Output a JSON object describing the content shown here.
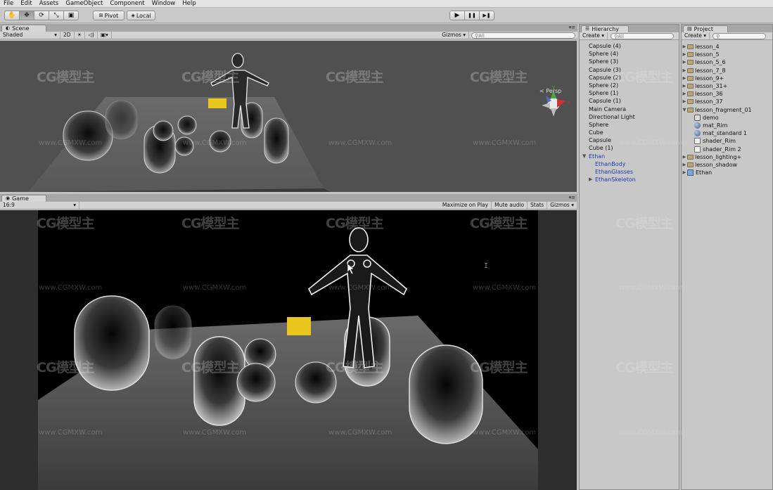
{
  "menu": [
    "File",
    "Edit",
    "Assets",
    "GameObject",
    "Component",
    "Window",
    "Help"
  ],
  "toolbar": {
    "tools": [
      "hand-icon",
      "move-icon",
      "rotate-icon",
      "scale-icon",
      "rect-icon"
    ],
    "pivot": "Pivot",
    "local": "Local",
    "play": "▶",
    "pause": "❚❚",
    "step": "▶❚"
  },
  "scene": {
    "tab": "Scene",
    "shading": "Shaded",
    "mode2d": "2D",
    "gizmos": "Gizmos",
    "search_placeholder": "All",
    "persp_label": "< Persp",
    "axis_x": "x",
    "axis_y": "y"
  },
  "game": {
    "tab": "Game",
    "aspect": "16:9",
    "buttons": [
      "Maximize on Play",
      "Mute audio",
      "Stats",
      "Gizmos"
    ]
  },
  "hierarchy": {
    "tab": "Hierarchy",
    "create": "Create",
    "search_placeholder": "All",
    "items": [
      {
        "label": "Capsule (4)"
      },
      {
        "label": "Sphere (4)"
      },
      {
        "label": "Sphere (3)"
      },
      {
        "label": "Capsule (3)"
      },
      {
        "label": "Capsule (2)"
      },
      {
        "label": "Sphere (2)"
      },
      {
        "label": "Sphere (1)"
      },
      {
        "label": "Capsule (1)"
      },
      {
        "label": "Main Camera"
      },
      {
        "label": "Directional Light"
      },
      {
        "label": "Sphere"
      },
      {
        "label": "Cube"
      },
      {
        "label": "Capsule"
      },
      {
        "label": "Cube (1)"
      },
      {
        "label": "Ethan"
      },
      {
        "label": "EthanBody"
      },
      {
        "label": "EthanGlasses"
      },
      {
        "label": "EthanSkeleton"
      }
    ]
  },
  "project": {
    "tab": "Project",
    "create": "Create",
    "items": [
      {
        "label": "lesson_4"
      },
      {
        "label": "lesson_5"
      },
      {
        "label": "lesson_5_6"
      },
      {
        "label": "lesson_7_8"
      },
      {
        "label": "lesson_9+"
      },
      {
        "label": "lesson_31+"
      },
      {
        "label": "lesson_36"
      },
      {
        "label": "lesson_37"
      },
      {
        "label": "lesson_fragment_01"
      },
      {
        "label": "demo"
      },
      {
        "label": "mat_Rim"
      },
      {
        "label": "mat_standard 1"
      },
      {
        "label": "shader_Rim"
      },
      {
        "label": "shader_Rim 2"
      },
      {
        "label": "lesson_lighting+"
      },
      {
        "label": "lesson_shadow"
      },
      {
        "label": "Ethan"
      }
    ]
  },
  "watermark": {
    "logo": "CG模型主",
    "url": "www.CGMXW.com"
  },
  "colors": {
    "cube_yellow": "#e8c61c",
    "scene_bg": "#505050",
    "game_bg": "#000000",
    "prefab_blue": "#1c3bb0"
  }
}
